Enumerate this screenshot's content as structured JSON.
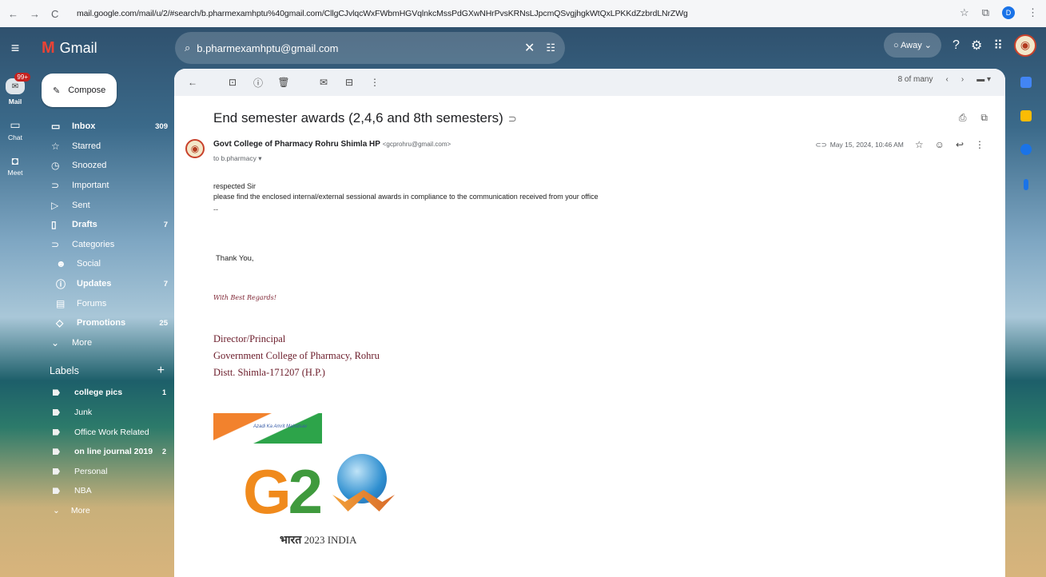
{
  "browser": {
    "url": "mail.google.com/mail/u/2/#search/b.pharmexamhptu%40gmail.com/CllgCJvlqcWxFWbmHGVqlnkcMssPdGXwNHrPvsKRNsLJpcmQSvgjhgkWtQxLPKKdZzbrdLNrZWg",
    "profile_letter": "D"
  },
  "header": {
    "app_name": "Gmail",
    "search_query": "b.pharmexamhptu@gmail.com",
    "status": "Away"
  },
  "rail": {
    "badge": "99+",
    "mail_label": "Mail",
    "chat_label": "Chat",
    "meet_label": "Meet"
  },
  "sidebar": {
    "compose_label": "Compose",
    "nav": [
      {
        "label": "Inbox",
        "count": "309",
        "icon": "inbox-icon",
        "bold": true
      },
      {
        "label": "Starred",
        "count": "",
        "icon": "star-icon"
      },
      {
        "label": "Snoozed",
        "count": "",
        "icon": "clock-icon"
      },
      {
        "label": "Important",
        "count": "",
        "icon": "important-icon"
      },
      {
        "label": "Sent",
        "count": "",
        "icon": "send-icon"
      },
      {
        "label": "Drafts",
        "count": "7",
        "icon": "draft-icon",
        "bold": true
      },
      {
        "label": "Categories",
        "count": "",
        "icon": "label-icon"
      },
      {
        "label": "Social",
        "count": "",
        "icon": "people-icon"
      },
      {
        "label": "Updates",
        "count": "7",
        "icon": "info-icon",
        "bold": true
      },
      {
        "label": "Forums",
        "count": "",
        "icon": "forum-icon"
      },
      {
        "label": "Promotions",
        "count": "25",
        "icon": "tag-icon",
        "bold": true
      },
      {
        "label": "More",
        "count": "",
        "icon": "chevron-down-icon"
      }
    ],
    "labels_heading": "Labels",
    "labels": [
      {
        "label": "college pics",
        "count": "1",
        "bold": true
      },
      {
        "label": "Junk",
        "count": ""
      },
      {
        "label": "Office Work Related",
        "count": ""
      },
      {
        "label": "on line journal 2019",
        "count": "2",
        "bold": true
      },
      {
        "label": "Personal",
        "count": ""
      },
      {
        "label": "NBA",
        "count": ""
      },
      {
        "label": "More",
        "count": ""
      }
    ]
  },
  "toolbar": {
    "pagination": "8 of many"
  },
  "email": {
    "subject": "End semester awards (2,4,6 and 8th semesters)",
    "sender_name": "Govt College of Pharmacy Rohru Shimla HP",
    "sender_email": "<gcprohru@gmail.com>",
    "to": "to b.pharmacy",
    "date": "May 15, 2024, 10:46 AM",
    "greeting": "respected Sir",
    "body": "please find the enclosed internal/external sessional awards in compliance to the communication received from your office",
    "separator": "--",
    "thanks": "Thank You,",
    "regards": "With Best Regards!",
    "sig_line1": "Director/Principal",
    "sig_line2": "Government College of Pharmacy, Rohru",
    "sig_line3": "Distt. Shimla-171207 (H.P.)",
    "g20_caption_hindi": "भारत",
    "g20_caption": "2023 INDIA"
  }
}
